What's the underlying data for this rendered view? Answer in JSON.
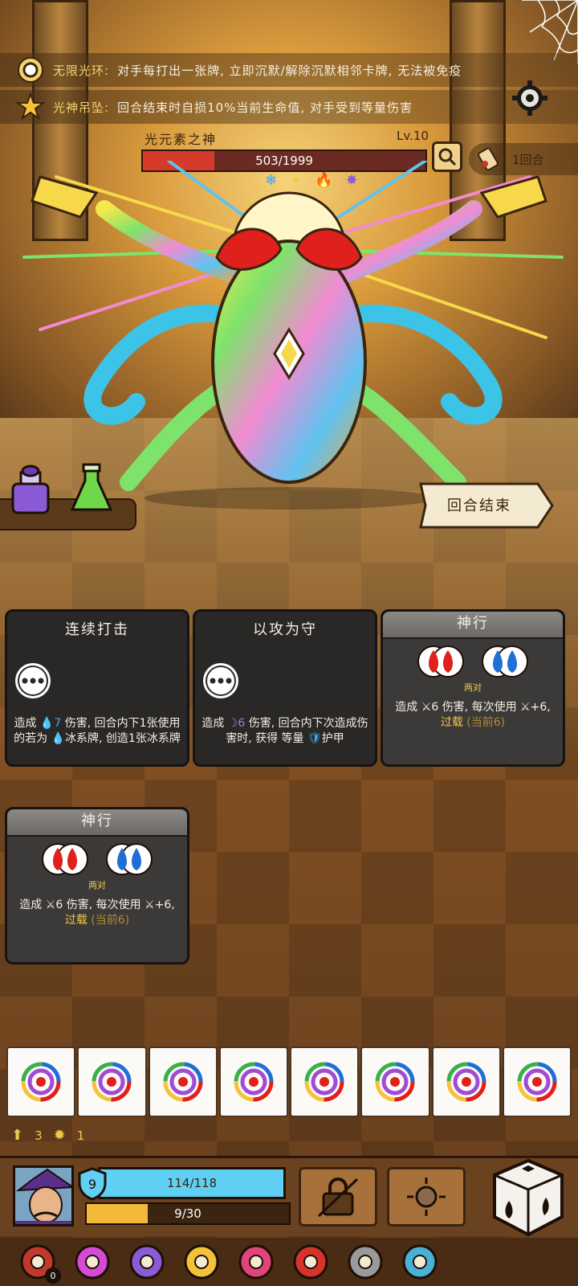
{
  "buffs": [
    {
      "name": "无限光环:",
      "desc": "对手每打出一张牌, 立即沉默/解除沉默相邻卡牌, 无法被免疫",
      "icon": "sun-ring-icon"
    },
    {
      "name": "光神吊坠:",
      "desc": "回合结束时自损10%当前生命值, 对手受到等量伤害",
      "icon": "star-pendant-icon"
    }
  ],
  "boss": {
    "name": "光元素之神",
    "level": "Lv.10",
    "hp_text": "503/1999",
    "hp_current": 503,
    "hp_max": 1999,
    "elements": [
      "❄",
      "✦",
      "🔥",
      "✸"
    ]
  },
  "round": {
    "text": "1回合"
  },
  "end_turn_label": "回合结束",
  "cards": [
    {
      "title": "连续打击",
      "desc_a": "造成",
      "icon_a": "💧",
      "value_a": "7",
      "desc_b": "伤害, 回合内下1张使用的若为",
      "icon_b": "💧",
      "desc_c": "冰系牌, 创造1张冰系牌"
    },
    {
      "title": "以攻为守",
      "desc_a": "造成",
      "icon_a": "☽",
      "value_a": "6",
      "desc_b": "伤害, 回合内下次造成伤害时, 获得 等量",
      "icon_b": "🛡",
      "desc_c": "护甲"
    },
    {
      "title": "神行",
      "pair_label": "两对",
      "desc_a": "造成",
      "icon_a": "⚔",
      "value_a": "6",
      "desc_b": "伤害, 每次使用",
      "icon_b": "⚔",
      "plus": "+6,",
      "overload": "过载",
      "current": "(当前6)"
    },
    {
      "title": "神行",
      "pair_label": "两对",
      "desc_a": "造成",
      "icon_a": "⚔",
      "value_a": "6",
      "desc_b": "伤害, 每次使用",
      "icon_b": "⚔",
      "plus": "+6,",
      "overload": "过载",
      "current": "(当前6)"
    }
  ],
  "dice_count": 8,
  "resources": {
    "gold": "3",
    "flame": "1"
  },
  "player": {
    "shield": "9",
    "hp_text": "114/118",
    "hp_current": 114,
    "hp_max": 118,
    "exp_text": "9/30",
    "exp_current": 9,
    "exp_max": 30
  },
  "relics": [
    {
      "name": "lifebuoy-icon",
      "count": "0"
    },
    {
      "name": "paint-splash-icon"
    },
    {
      "name": "eye-flask-icon"
    },
    {
      "name": "sun-medal-icon"
    },
    {
      "name": "fire-swirl-icon"
    },
    {
      "name": "ruby-frame-icon"
    },
    {
      "name": "gargoyle-icon"
    },
    {
      "name": "sickle-icon"
    }
  ],
  "colors": {
    "hp_red": "#d63a2b",
    "hp_blue": "#5fd0f4",
    "exp_gold": "#f4b93a",
    "highlight": "#f1c94a"
  }
}
